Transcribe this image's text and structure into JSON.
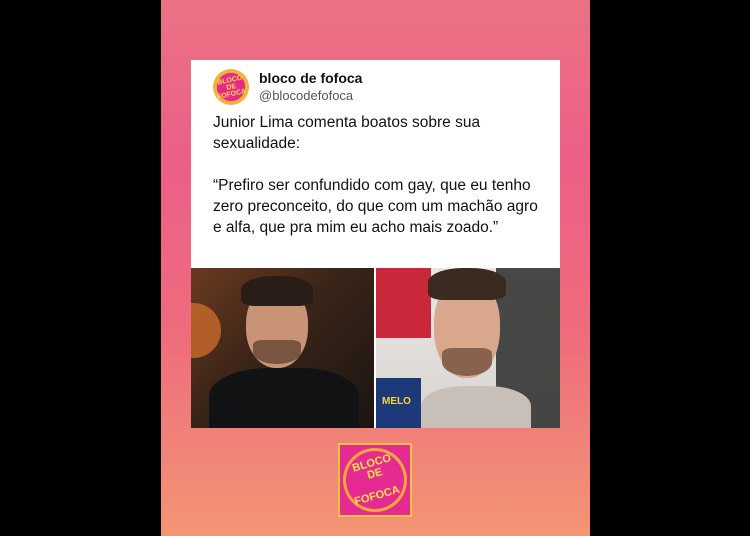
{
  "tweet": {
    "account_name": "bloco de fofoca",
    "handle": "@blocodefofoca",
    "text": "Junior Lima comenta boatos sobre sua sexualidade:\n\n“Prefiro ser confundido com gay, que eu tenho zero preconceito, do que com um machão agro e alfa, que pra mim eu acho mais zoado.”"
  },
  "avatar_logo": {
    "line1": "BLOCO DE",
    "line2": "FOFOCA"
  },
  "photos": {
    "right_poster_text": "MELO"
  },
  "footer_logo": {
    "line1": "BLOCO DE",
    "line2": "FOFOCA"
  },
  "colors": {
    "background": "#000000",
    "gradient_top": "#ea7283",
    "gradient_bottom": "#f39574",
    "brand_pink": "#e52a92",
    "brand_yellow": "#ffe54a"
  }
}
